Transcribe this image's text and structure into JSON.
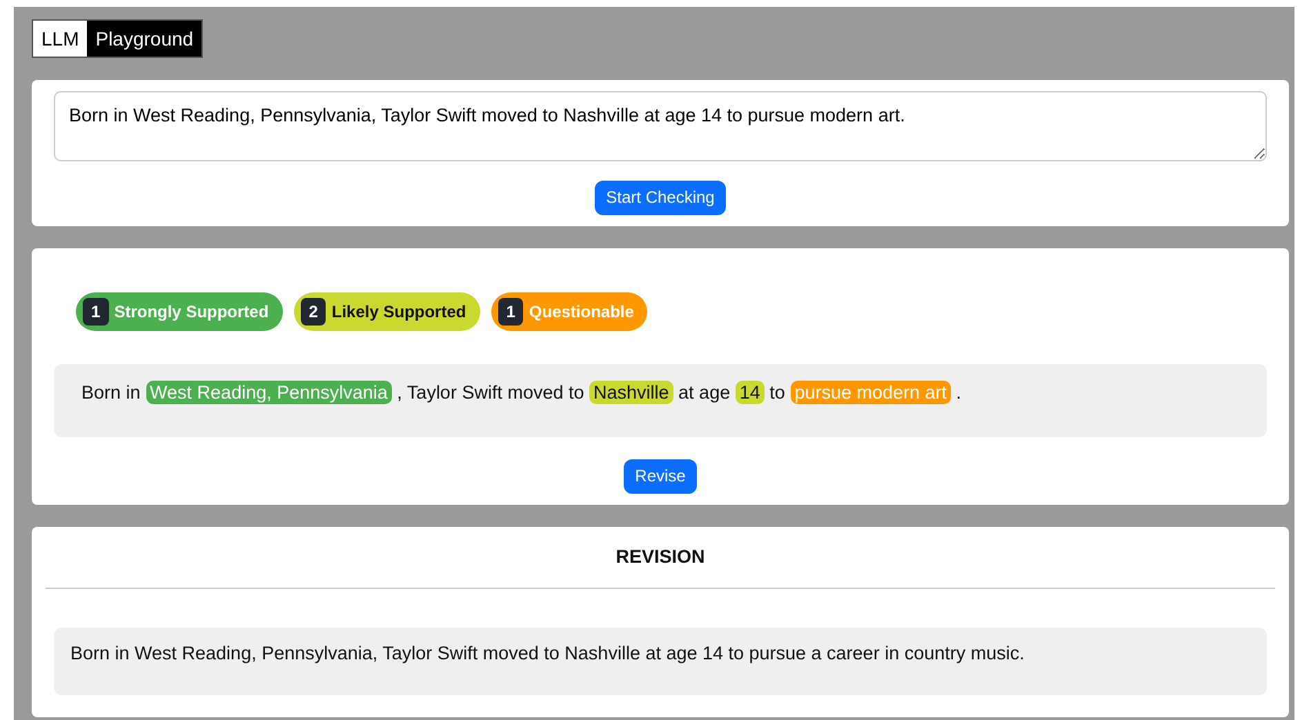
{
  "title": {
    "part_1": "LLM",
    "part_2": "Playground"
  },
  "input": {
    "value": "Born in West Reading, Pennsylvania, Taylor Swift moved to Nashville at age 14 to pursue modern art.",
    "button": "Start Checking"
  },
  "legend": [
    {
      "count": "1",
      "label": "Strongly Supported",
      "color": "#4caf50"
    },
    {
      "count": "2",
      "label": "Likely Supported",
      "color": "#c9d930"
    },
    {
      "count": "1",
      "label": "Questionable",
      "color": "#ff9800"
    }
  ],
  "annotated": [
    {
      "kind": "plain",
      "text": "Born in"
    },
    {
      "kind": "claim",
      "text": "West Reading, Pennsylvania",
      "color": "#4caf50"
    },
    {
      "kind": "plain",
      "text": ", Taylor Swift moved to"
    },
    {
      "kind": "claim",
      "text": "Nashville",
      "color": "#c9d930"
    },
    {
      "kind": "plain",
      "text": "at age"
    },
    {
      "kind": "claim",
      "text": "14",
      "color": "#c9d930"
    },
    {
      "kind": "plain",
      "text": "to"
    },
    {
      "kind": "claim",
      "text": "pursue modern art",
      "color": "#ff9800"
    },
    {
      "kind": "plain",
      "text": "."
    }
  ],
  "revise_button": "Revise",
  "revision": {
    "heading": "REVISION",
    "text": "Born in West Reading, Pennsylvania, Taylor Swift moved to Nashville at age 14 to pursue a career in country music."
  }
}
